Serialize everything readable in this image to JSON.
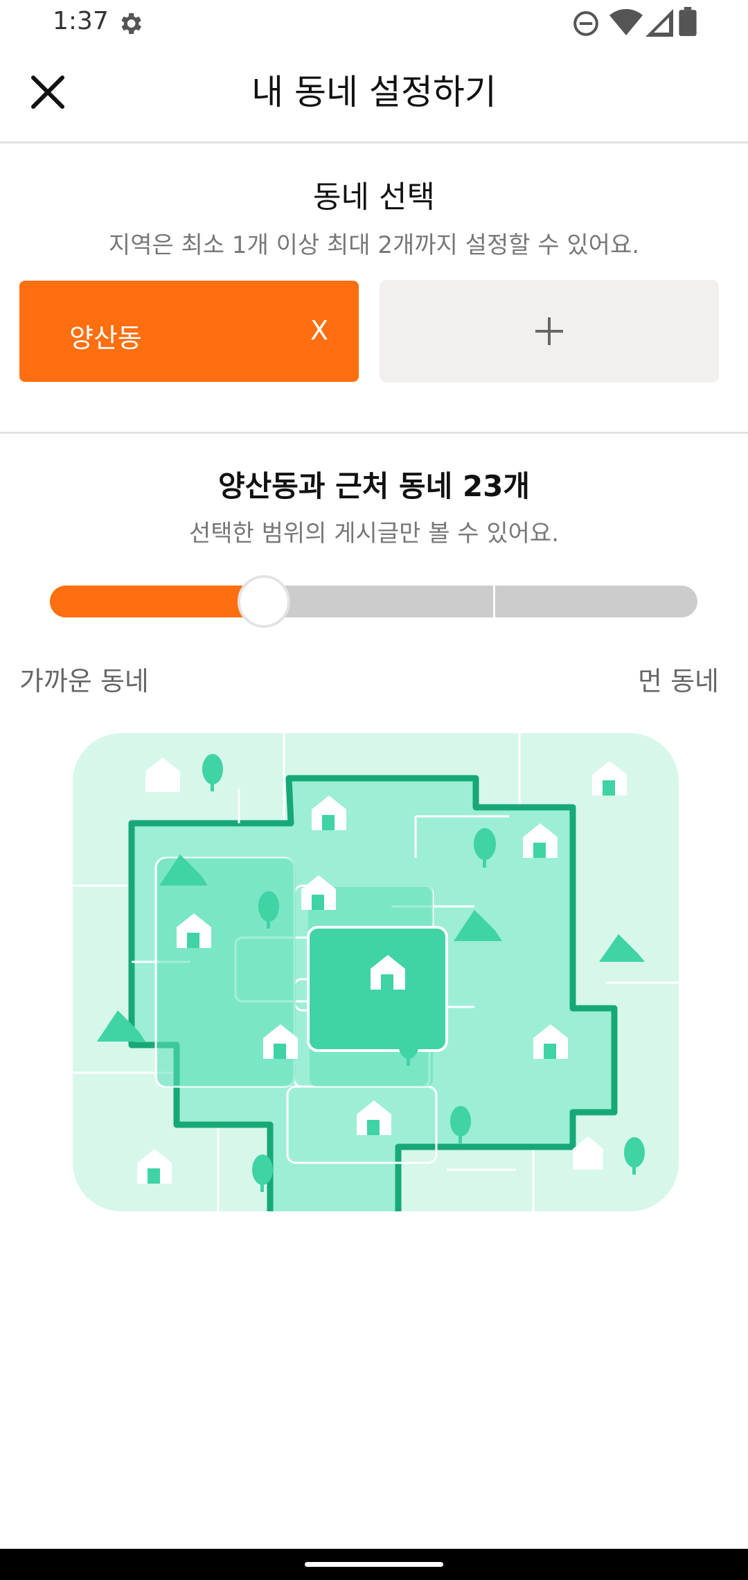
{
  "status": {
    "time": "1:37",
    "icons": [
      "gear-icon",
      "do-not-disturb-icon",
      "wifi-icon",
      "signal-icon",
      "battery-icon"
    ]
  },
  "header": {
    "title": "내 동네 설정하기",
    "close_icon": "close-icon"
  },
  "select_section": {
    "title": "동네 선택",
    "subtitle": "지역은 최소 1개 이상 최대 2개까지 설정할 수 있어요.",
    "selected_region": "양산동",
    "remove_label": "X",
    "add_icon": "plus-icon"
  },
  "range_section": {
    "title": "양산동과 근처 동네 23개",
    "subtitle": "선택한 범위의 게시글만 볼 수 있어요.",
    "slider_level_fraction": 0.33,
    "near_label": "가까운 동네",
    "far_label": "먼 동네"
  },
  "colors": {
    "accent": "#ff6f0f",
    "map_light": "#d6f7ea",
    "map_mid": "#9ceed4",
    "map_strong": "#5fe0b9",
    "map_outline": "#17a877"
  }
}
